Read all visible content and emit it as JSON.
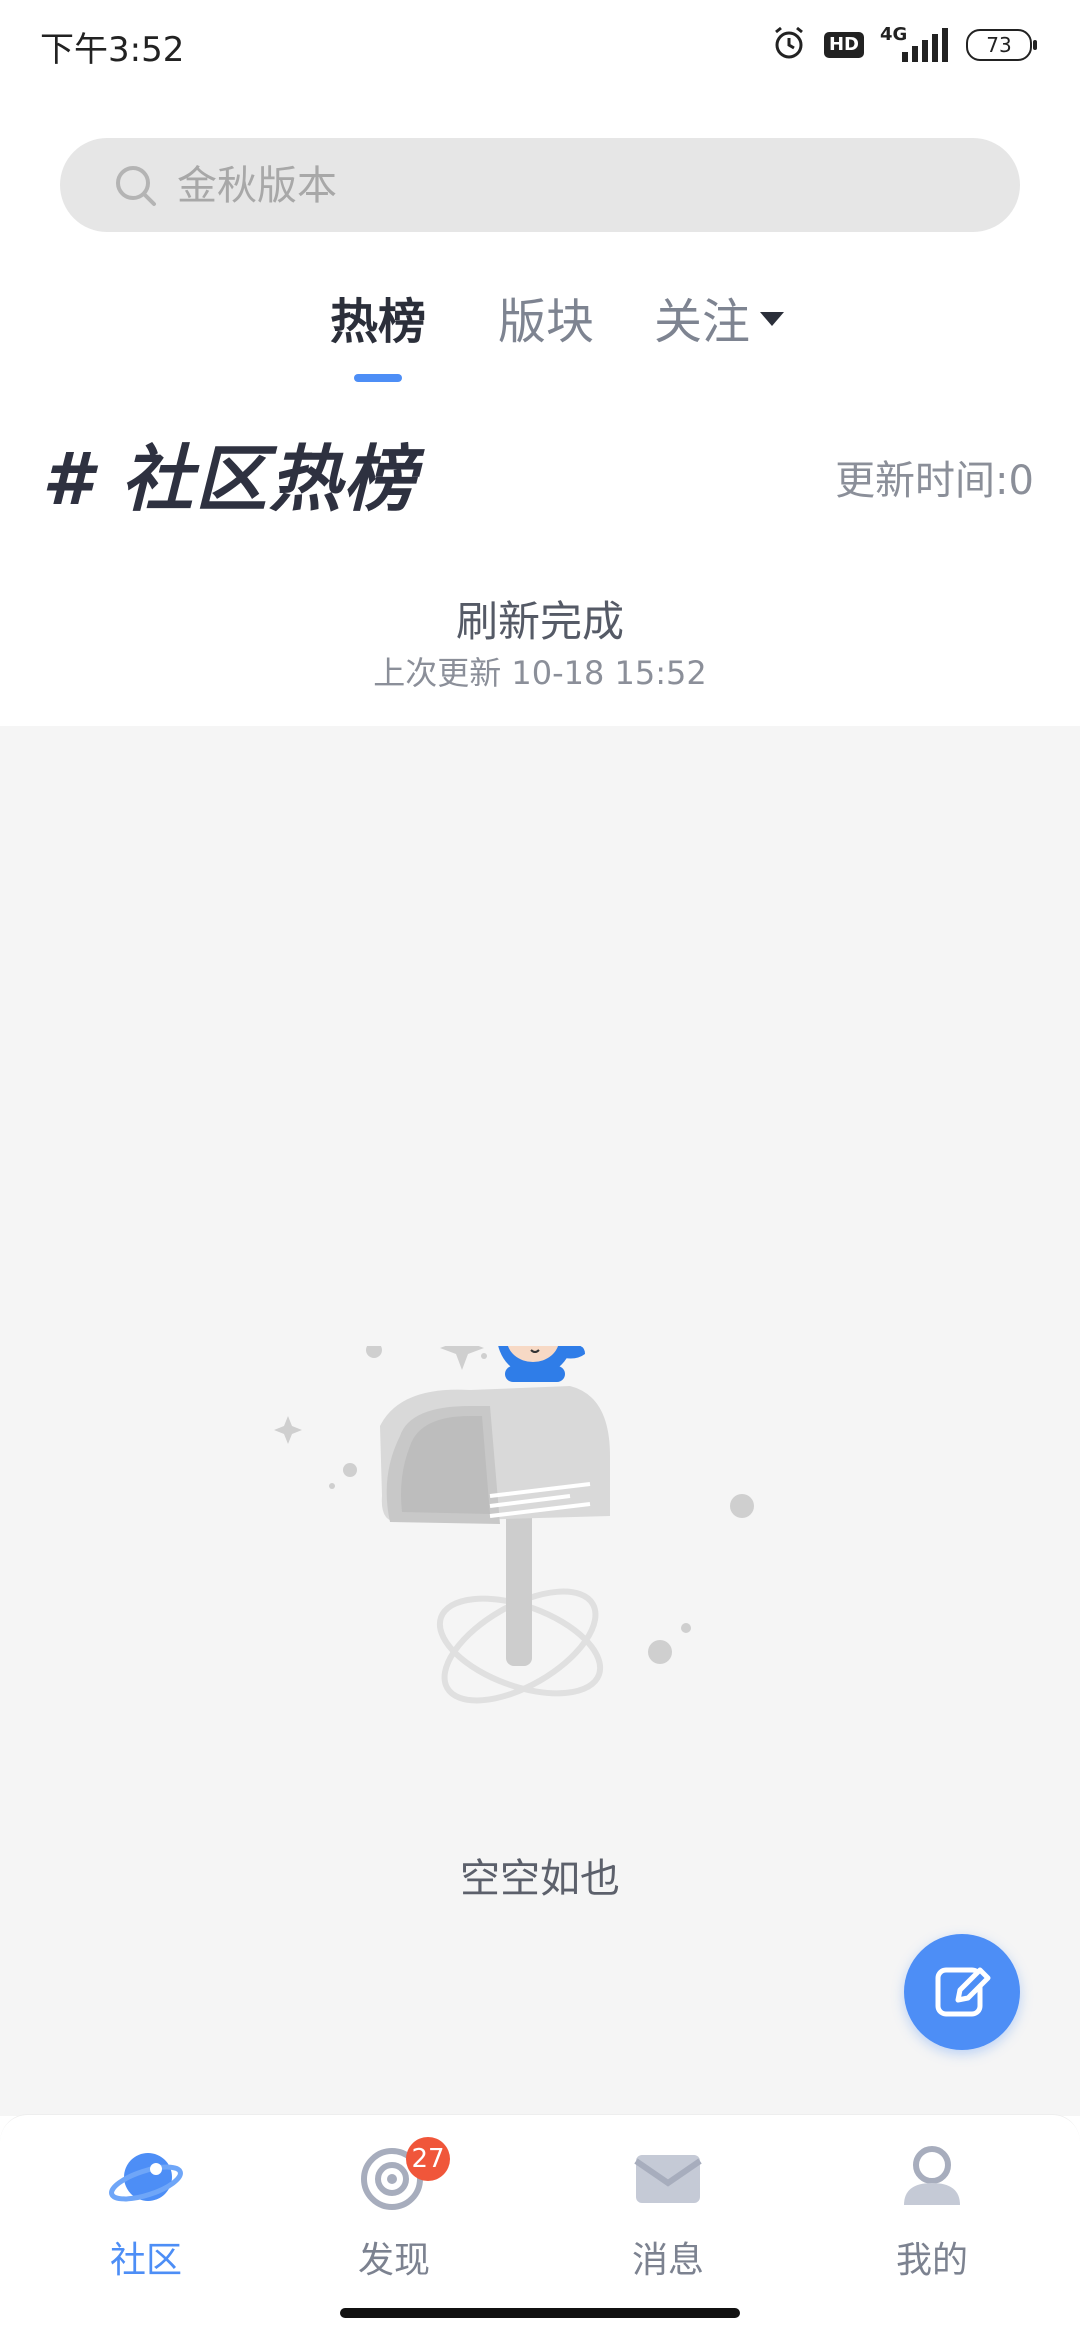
{
  "status_bar": {
    "time": "下午3:52",
    "hd": "HD",
    "network": "4G",
    "battery": "73"
  },
  "search": {
    "placeholder": "金秋版本"
  },
  "tabs": [
    {
      "label": "热榜",
      "active": true
    },
    {
      "label": "版块",
      "active": false
    },
    {
      "label": "关注",
      "active": false
    }
  ],
  "hot_list": {
    "title": "# 社区热榜",
    "update_time": "更新时间:0"
  },
  "refresh": {
    "status": "刷新完成",
    "last_update": "上次更新 10-18 15:52"
  },
  "empty_state": {
    "text": "空空如也",
    "icon": "empty-mailbox-illustration"
  },
  "compose": {
    "icon": "edit-icon"
  },
  "bottom_nav": [
    {
      "label": "社区",
      "icon": "community-planet-icon",
      "active": true
    },
    {
      "label": "发现",
      "icon": "discover-icon",
      "badge": "27",
      "active": false
    },
    {
      "label": "消息",
      "icon": "message-envelope-icon",
      "active": false
    },
    {
      "label": "我的",
      "icon": "profile-icon",
      "active": false
    }
  ],
  "colors": {
    "accent": "#4d8ef6",
    "badge": "#f0563a",
    "background_gray": "#f5f5f5"
  }
}
